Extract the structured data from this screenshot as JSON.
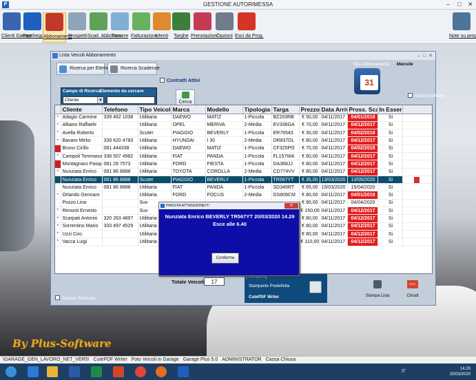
{
  "app": {
    "title": "GESTIONE AUTORIMESSA",
    "window_controls": [
      "–",
      "□",
      "✕"
    ]
  },
  "toolbar": {
    "items": [
      {
        "label": "Clienti Garage",
        "icon": "person-icon",
        "color": "#3a66b0"
      },
      {
        "label": "Parcheggio",
        "icon": "parking-icon",
        "color": "#1f5fbf"
      },
      {
        "label": "Abbonamenti",
        "icon": "calendar-2020-icon",
        "color": "#c0392b"
      },
      {
        "label": "Prospetti",
        "icon": "document-icon",
        "color": "#8fa4b9"
      },
      {
        "label": "Scad. Abbonam.",
        "icon": "calendar-20-icon",
        "color": "#5fa35a"
      },
      {
        "label": "Tessere",
        "icon": "card-icon",
        "color": "#7fb0d3"
      },
      {
        "label": "Fatturazione",
        "icon": "invoice-icon",
        "color": "#67b25e"
      },
      {
        "label": "Utenti",
        "icon": "users-icon",
        "color": "#e08a2f"
      },
      {
        "label": "Targhe",
        "icon": "car-icon",
        "color": "#3d7e3a"
      },
      {
        "label": "Prenotazioni",
        "icon": "booking-icon",
        "color": "#c63a56"
      },
      {
        "label": "Opzioni",
        "icon": "tools-icon",
        "color": "#6f7c8a"
      },
      {
        "label": "Esci da Prog.",
        "icon": "power-icon",
        "color": "#d43526"
      }
    ],
    "right_item": {
      "label": "Note su prog",
      "icon": "notes-icon",
      "color": "#4d7599"
    }
  },
  "window": {
    "title": "Lista Veicoli Abbonamento",
    "controls": [
      "–",
      "□",
      "✕"
    ]
  },
  "controls": {
    "btn_ricerca": "Ricerca per Elemento",
    "btn_scadenze": "Ricerca Scadenze",
    "contratti_attivi": "Contratti Attivi",
    "campo_label": "Campo di Ricerca",
    "elemento_label": "Elemento da cercare",
    "campo_value": "Cliente",
    "cerca": "Cerca",
    "tipo_abbonamento_label": "Tipo abbonamento",
    "tipo_abbonamento_value": "Mensile",
    "calendar_day": "31",
    "abilita_modifiche": "Abilita Modifiche"
  },
  "table": {
    "columns": [
      "",
      "Cliente",
      "Telefono",
      "Tipo Veicolo",
      "Marca",
      "Modello",
      "Tipologia",
      "Targa",
      "Prezzo",
      "Data Arrivo",
      "Pross. Scad.",
      "In Essere",
      ""
    ],
    "rows": [
      {
        "ind": "*",
        "red": false,
        "cliente": "Adagio Carmine",
        "tel": "339 462 1038",
        "tipo": "Utilitaria",
        "marca": "DAEWO",
        "modello": "MATIZ",
        "tipologia": "1-Piccola",
        "targa": "BZ203RB",
        "prezzo": "€ 50,00",
        "arrivo": "04/11/2017",
        "scad": "04/01/2018",
        "due": true,
        "essere": "Si"
      },
      {
        "ind": "*",
        "red": false,
        "cliente": "Albano Raffaele",
        "tel": "",
        "tipo": "Utilitaria",
        "marca": "OPEL",
        "modello": "MERIVA",
        "tipologia": "2-Media",
        "targa": "EV336GA",
        "prezzo": "€ 70,00",
        "arrivo": "04/11/2017",
        "scad": "04/12/2017",
        "due": true,
        "essere": "Si"
      },
      {
        "ind": "*",
        "red": false,
        "cliente": "Avella Roberto",
        "tel": "",
        "tipo": "Scuter",
        "marca": "PIAGGIO",
        "modello": "BEVERLY",
        "tipologia": "1-Piccola",
        "targa": "ER76543",
        "prezzo": "€ 30,00",
        "arrivo": "04/11/2017",
        "scad": "04/02/2018",
        "due": true,
        "essere": "Si"
      },
      {
        "ind": "*",
        "red": false,
        "cliente": "Bavaro Mirko",
        "tel": "339 620 4783",
        "tipo": "Utilitaria",
        "marca": "HYUNDAI",
        "modello": "I 30",
        "tipologia": "2-Media",
        "targa": "DR837DL",
        "prezzo": "€ 80,00",
        "arrivo": "04/11/2017",
        "scad": "04/12/2017",
        "due": true,
        "essere": "Si"
      },
      {
        "ind": "",
        "red": true,
        "cliente": "Bruno Cirillo",
        "tel": "081 444338",
        "tipo": "Utilitaria",
        "marca": "DAEWO",
        "modello": "MATIZ",
        "tipologia": "1-Piccola",
        "targa": "CF325PO",
        "prezzo": "€ 70,00",
        "arrivo": "04/11/2017",
        "scad": "04/02/2018",
        "due": true,
        "essere": "Si"
      },
      {
        "ind": "*",
        "red": false,
        "cliente": "Campoli Tommaso",
        "tel": "338 507 4982",
        "tipo": "Utilitaria",
        "marca": "FIAT",
        "modello": "PANDA",
        "tipologia": "1-Piccola",
        "targa": "FL157WA",
        "prezzo": "€ 60,00",
        "arrivo": "04/11/2017",
        "scad": "04/12/2017",
        "due": true,
        "essere": "Si"
      },
      {
        "ind": "",
        "red": true,
        "cliente": "Montagnaro Pasquale",
        "tel": "081 29 7573",
        "tipo": "Utilitaria",
        "marca": "FORD",
        "modello": "FIESTA",
        "tipologia": "1-Piccola",
        "targa": "DA368JJ",
        "prezzo": "€ 80,00",
        "arrivo": "04/11/2017",
        "scad": "04/12/2017",
        "due": true,
        "essere": "Si"
      },
      {
        "ind": "*",
        "red": false,
        "cliente": "Nunziata Enrico",
        "tel": "081 86 8888",
        "tipo": "Utilitaria",
        "marca": "TOYOTA",
        "modello": "COROLLA",
        "tipologia": "2-Media",
        "targa": "CD774VV",
        "prezzo": "€ 80,00",
        "arrivo": "04/11/2017",
        "scad": "04/12/2017",
        "due": true,
        "essere": "Si"
      },
      {
        "ind": "",
        "red": false,
        "selected": true,
        "cliente": "Nunziata Enrico",
        "tel": "081 86 8888",
        "tipo": "Scuter",
        "marca": "PIAGGIO",
        "modello": "BEVERLY",
        "tipologia": "1-Piccola",
        "targa": "TR567YT",
        "prezzo": "€ 35,00",
        "arrivo": "13/03/2020",
        "scad": "13/05/2020",
        "due": false,
        "essere": "Si"
      },
      {
        "ind": "",
        "red": false,
        "cliente": "Nunziata Enrico",
        "tel": "081 86 8888",
        "tipo": "Utilitaria",
        "marca": "FIAT",
        "modello": "PANDA",
        "tipologia": "1-Piccola",
        "targa": "SD345RT",
        "prezzo": "€ 65,00",
        "arrivo": "15/03/2020",
        "scad": "15/04/2020",
        "due": false,
        "essere": "Si"
      },
      {
        "ind": "*",
        "red": false,
        "cliente": "Orlando Gennaro",
        "tel": "",
        "tipo": "Utilitaria",
        "marca": "FORD",
        "modello": "FOCUS",
        "tipologia": "2-Media",
        "targa": "DS809CM",
        "prezzo": "€ 80,00",
        "arrivo": "04/11/2017",
        "scad": "04/01/2018",
        "due": true,
        "essere": "Si"
      },
      {
        "ind": "",
        "red": false,
        "cliente": "Pozzo Lina",
        "tel": "",
        "tipo": "Suv",
        "marca": "",
        "modello": "",
        "tipologia": "",
        "targa": "",
        "prezzo": "€ 90,00",
        "arrivo": "04/11/2017",
        "scad": "04/04/2020",
        "due": false,
        "essere": "Si"
      },
      {
        "ind": "*",
        "red": false,
        "cliente": "Rimonti Ernesto",
        "tel": "",
        "tipo": "Suv",
        "marca": "",
        "modello": "",
        "tipologia": "",
        "targa": "",
        "prezzo": "€ 150,00",
        "arrivo": "04/11/2017",
        "scad": "04/12/2017",
        "due": true,
        "essere": "Si"
      },
      {
        "ind": "*",
        "red": false,
        "cliente": "Scarpati Antonio",
        "tel": "320 263 4897",
        "tipo": "Utilitaria",
        "marca": "",
        "modello": "",
        "tipologia": "",
        "targa": "",
        "prezzo": "€ 80,00",
        "arrivo": "04/11/2017",
        "scad": "04/12/2017",
        "due": true,
        "essere": "Si"
      },
      {
        "ind": "*",
        "red": false,
        "cliente": "Sorrentino Mario",
        "tel": "333 497 4529",
        "tipo": "Utilitaria",
        "marca": "",
        "modello": "",
        "tipologia": "",
        "targa": "",
        "prezzo": "€ 80,00",
        "arrivo": "04/11/2017",
        "scad": "04/12/2017",
        "due": true,
        "essere": "Si"
      },
      {
        "ind": "*",
        "red": false,
        "cliente": "Uzzi Ciro",
        "tel": "",
        "tipo": "Utilitaria",
        "marca": "",
        "modello": "",
        "tipologia": "",
        "targa": "",
        "prezzo": "€ 80,00",
        "arrivo": "04/11/2017",
        "scad": "04/12/2017",
        "due": true,
        "essere": "Si"
      },
      {
        "ind": "*",
        "red": false,
        "cliente": "Vacca Luigi",
        "tel": "",
        "tipo": "Utilitaria",
        "marca": "",
        "modello": "",
        "tipologia": "",
        "targa": "",
        "prezzo": "€ 110,00",
        "arrivo": "04/11/2017",
        "scad": "04/12/2017",
        "due": true,
        "essere": "Si"
      }
    ]
  },
  "footer": {
    "totale_label": "Totale Veicoli",
    "totale_value": "17",
    "stampanti_label": "[Stampanti]",
    "stampante_predefinita": "Stampante Predefinita",
    "printer_name": "CutePDF Writer",
    "stampa_ricevuta": "Stampa Ricevuta",
    "stampa_lista": "Stampa Lista",
    "chiudi": "Chiudi",
    "chiudi_icon_text": "EXIT"
  },
  "alert": {
    "title": "PRESTA ATTENZIONE!!!!",
    "close": "✕",
    "line1": "Nunziata Enrico  BEVERLY  TR567YT  20/03/2020  14.29",
    "line2": "Esce alle 6.40",
    "button": "Conferma"
  },
  "watermark": "By Plus-Software",
  "statusbar": {
    "items": [
      "\\GARAGE_GEN_LAVORO_NET_VER5\\",
      "CutePDF Writer",
      "Foto Veicoli in Garage",
      "Garage Plus 5.0",
      "ADMINISTRATOR",
      "Cassa Chiusa"
    ]
  },
  "taskbar": {
    "apps": [
      {
        "name": "start-icon",
        "color": "#3b8fd9"
      },
      {
        "name": "browser-icon",
        "color": "#2a7ad6"
      },
      {
        "name": "folder-icon",
        "color": "#e9b33a"
      },
      {
        "name": "word-icon",
        "color": "#2b5aa8"
      },
      {
        "name": "excel-icon",
        "color": "#1f8a48"
      },
      {
        "name": "powerpoint-icon",
        "color": "#d24726"
      },
      {
        "name": "chrome-icon",
        "color": "#e0453a"
      },
      {
        "name": "firefox-icon",
        "color": "#e86c1d"
      },
      {
        "name": "garage-app-icon",
        "color": "#1f5fbf"
      }
    ],
    "lang": "IT",
    "time": "14.29",
    "date": "20/03/2020"
  }
}
